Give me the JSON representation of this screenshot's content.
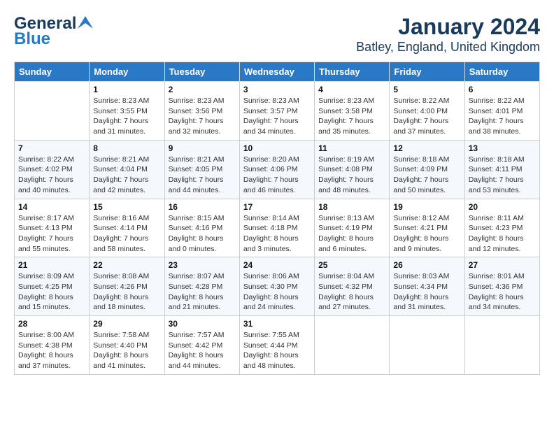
{
  "logo": {
    "text_general": "General",
    "text_blue": "Blue"
  },
  "header": {
    "month": "January 2024",
    "location": "Batley, England, United Kingdom"
  },
  "weekdays": [
    "Sunday",
    "Monday",
    "Tuesday",
    "Wednesday",
    "Thursday",
    "Friday",
    "Saturday"
  ],
  "weeks": [
    [
      {
        "day": "",
        "info": ""
      },
      {
        "day": "1",
        "info": "Sunrise: 8:23 AM\nSunset: 3:55 PM\nDaylight: 7 hours\nand 31 minutes."
      },
      {
        "day": "2",
        "info": "Sunrise: 8:23 AM\nSunset: 3:56 PM\nDaylight: 7 hours\nand 32 minutes."
      },
      {
        "day": "3",
        "info": "Sunrise: 8:23 AM\nSunset: 3:57 PM\nDaylight: 7 hours\nand 34 minutes."
      },
      {
        "day": "4",
        "info": "Sunrise: 8:23 AM\nSunset: 3:58 PM\nDaylight: 7 hours\nand 35 minutes."
      },
      {
        "day": "5",
        "info": "Sunrise: 8:22 AM\nSunset: 4:00 PM\nDaylight: 7 hours\nand 37 minutes."
      },
      {
        "day": "6",
        "info": "Sunrise: 8:22 AM\nSunset: 4:01 PM\nDaylight: 7 hours\nand 38 minutes."
      }
    ],
    [
      {
        "day": "7",
        "info": "Sunrise: 8:22 AM\nSunset: 4:02 PM\nDaylight: 7 hours\nand 40 minutes."
      },
      {
        "day": "8",
        "info": "Sunrise: 8:21 AM\nSunset: 4:04 PM\nDaylight: 7 hours\nand 42 minutes."
      },
      {
        "day": "9",
        "info": "Sunrise: 8:21 AM\nSunset: 4:05 PM\nDaylight: 7 hours\nand 44 minutes."
      },
      {
        "day": "10",
        "info": "Sunrise: 8:20 AM\nSunset: 4:06 PM\nDaylight: 7 hours\nand 46 minutes."
      },
      {
        "day": "11",
        "info": "Sunrise: 8:19 AM\nSunset: 4:08 PM\nDaylight: 7 hours\nand 48 minutes."
      },
      {
        "day": "12",
        "info": "Sunrise: 8:18 AM\nSunset: 4:09 PM\nDaylight: 7 hours\nand 50 minutes."
      },
      {
        "day": "13",
        "info": "Sunrise: 8:18 AM\nSunset: 4:11 PM\nDaylight: 7 hours\nand 53 minutes."
      }
    ],
    [
      {
        "day": "14",
        "info": "Sunrise: 8:17 AM\nSunset: 4:13 PM\nDaylight: 7 hours\nand 55 minutes."
      },
      {
        "day": "15",
        "info": "Sunrise: 8:16 AM\nSunset: 4:14 PM\nDaylight: 7 hours\nand 58 minutes."
      },
      {
        "day": "16",
        "info": "Sunrise: 8:15 AM\nSunset: 4:16 PM\nDaylight: 8 hours\nand 0 minutes."
      },
      {
        "day": "17",
        "info": "Sunrise: 8:14 AM\nSunset: 4:18 PM\nDaylight: 8 hours\nand 3 minutes."
      },
      {
        "day": "18",
        "info": "Sunrise: 8:13 AM\nSunset: 4:19 PM\nDaylight: 8 hours\nand 6 minutes."
      },
      {
        "day": "19",
        "info": "Sunrise: 8:12 AM\nSunset: 4:21 PM\nDaylight: 8 hours\nand 9 minutes."
      },
      {
        "day": "20",
        "info": "Sunrise: 8:11 AM\nSunset: 4:23 PM\nDaylight: 8 hours\nand 12 minutes."
      }
    ],
    [
      {
        "day": "21",
        "info": "Sunrise: 8:09 AM\nSunset: 4:25 PM\nDaylight: 8 hours\nand 15 minutes."
      },
      {
        "day": "22",
        "info": "Sunrise: 8:08 AM\nSunset: 4:26 PM\nDaylight: 8 hours\nand 18 minutes."
      },
      {
        "day": "23",
        "info": "Sunrise: 8:07 AM\nSunset: 4:28 PM\nDaylight: 8 hours\nand 21 minutes."
      },
      {
        "day": "24",
        "info": "Sunrise: 8:06 AM\nSunset: 4:30 PM\nDaylight: 8 hours\nand 24 minutes."
      },
      {
        "day": "25",
        "info": "Sunrise: 8:04 AM\nSunset: 4:32 PM\nDaylight: 8 hours\nand 27 minutes."
      },
      {
        "day": "26",
        "info": "Sunrise: 8:03 AM\nSunset: 4:34 PM\nDaylight: 8 hours\nand 31 minutes."
      },
      {
        "day": "27",
        "info": "Sunrise: 8:01 AM\nSunset: 4:36 PM\nDaylight: 8 hours\nand 34 minutes."
      }
    ],
    [
      {
        "day": "28",
        "info": "Sunrise: 8:00 AM\nSunset: 4:38 PM\nDaylight: 8 hours\nand 37 minutes."
      },
      {
        "day": "29",
        "info": "Sunrise: 7:58 AM\nSunset: 4:40 PM\nDaylight: 8 hours\nand 41 minutes."
      },
      {
        "day": "30",
        "info": "Sunrise: 7:57 AM\nSunset: 4:42 PM\nDaylight: 8 hours\nand 44 minutes."
      },
      {
        "day": "31",
        "info": "Sunrise: 7:55 AM\nSunset: 4:44 PM\nDaylight: 8 hours\nand 48 minutes."
      },
      {
        "day": "",
        "info": ""
      },
      {
        "day": "",
        "info": ""
      },
      {
        "day": "",
        "info": ""
      }
    ]
  ]
}
